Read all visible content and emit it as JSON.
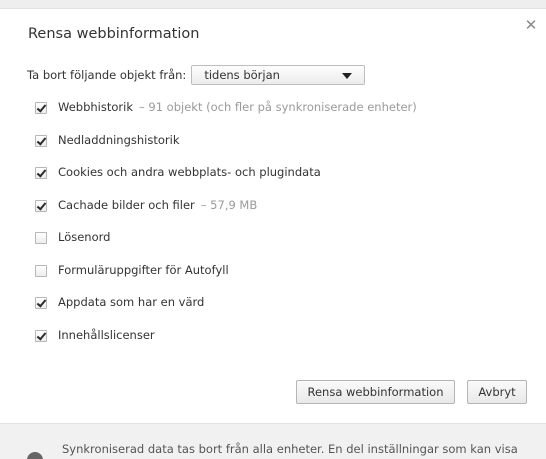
{
  "window": {
    "title": "Rensa webbinformation",
    "close_icon": "close-icon"
  },
  "period": {
    "label": "Ta bort följande objekt från:",
    "selected": "tidens början",
    "arrow_icon": "chevron-down-icon"
  },
  "options": [
    {
      "label": "Webbhistorik",
      "note": "– 91 objekt (och fler på synkroniserade enheter)",
      "checked": true
    },
    {
      "label": "Nedladdningshistorik",
      "note": "",
      "checked": true
    },
    {
      "label": "Cookies och andra webbplats- och plugindata",
      "note": "",
      "checked": true
    },
    {
      "label": "Cachade bilder och filer",
      "note": "– 57,9 MB",
      "checked": true
    },
    {
      "label": "Lösenord",
      "note": "",
      "checked": false
    },
    {
      "label": "Formuläruppgifter för Autofyll",
      "note": "",
      "checked": false
    },
    {
      "label": "Appdata som har en värd",
      "note": "",
      "checked": true
    },
    {
      "label": "Innehållslicenser",
      "note": "",
      "checked": true
    }
  ],
  "buttons": {
    "clear": "Rensa webbinformation",
    "cancel": "Avbryt"
  },
  "footer": {
    "icon": "info-icon",
    "text": "Synkroniserad data tas bort från alla enheter. En del inställningar som kan visa"
  }
}
